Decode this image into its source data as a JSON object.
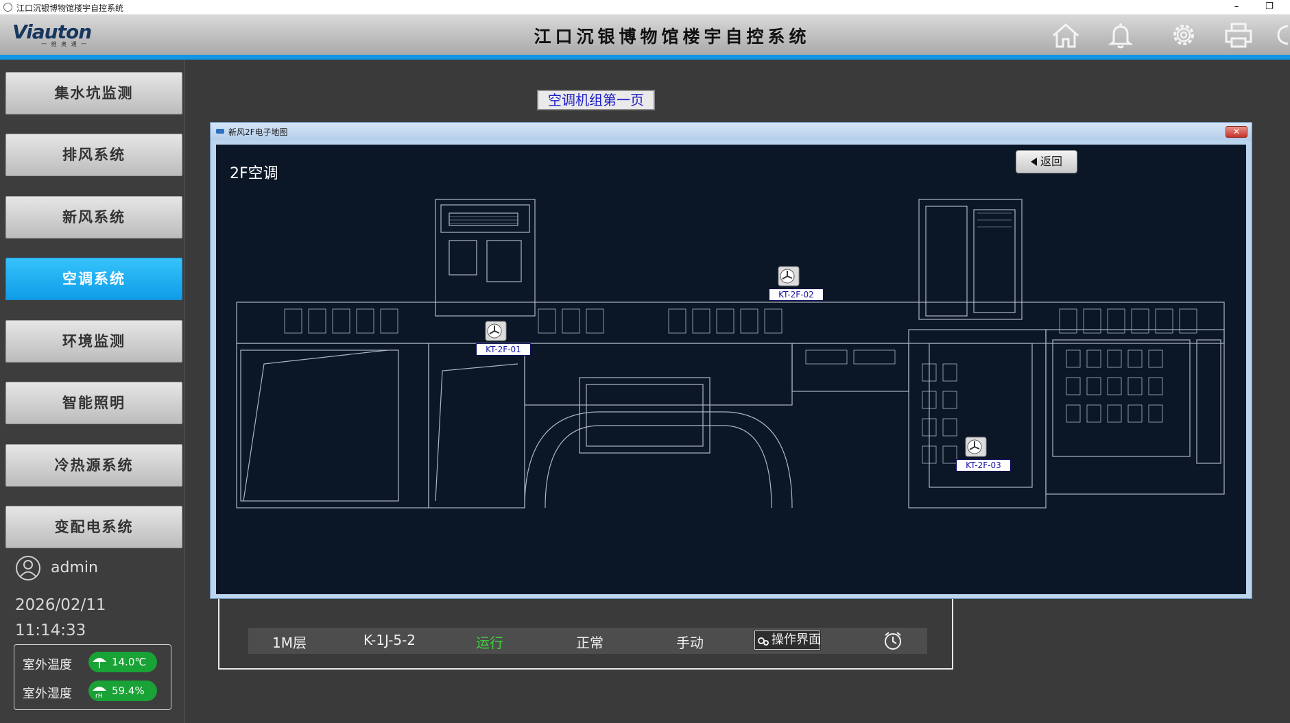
{
  "window": {
    "title": "江口沉银博物馆楼宇自控系统",
    "minimize": "–",
    "maximize": "❐"
  },
  "header": {
    "logo_main": "Viauton",
    "logo_sub": "一 维 奥 通 一",
    "title": "江口沉银博物馆楼宇自控系统"
  },
  "sidebar": {
    "items": [
      {
        "label": "集水坑监测",
        "active": false
      },
      {
        "label": "排风系统",
        "active": false
      },
      {
        "label": "新风系统",
        "active": false
      },
      {
        "label": "空调系统",
        "active": true
      },
      {
        "label": "环境监测",
        "active": false
      },
      {
        "label": "智能照明",
        "active": false
      },
      {
        "label": "冷热源系统",
        "active": false
      },
      {
        "label": "变配电系统",
        "active": false
      }
    ],
    "user": "admin",
    "date": "2026/02/11",
    "time": "11:14:33",
    "weather": {
      "temp_label": "室外温度",
      "temp_value": "14.0℃",
      "hum_label": "室外湿度",
      "hum_value": "59.4%"
    }
  },
  "main": {
    "page_link": "空调机组第一页",
    "status_row": {
      "floor": "1M层",
      "unit_id": "K-1J-5-2",
      "run_state": "运行",
      "fault_state": "正常",
      "mode": "手动",
      "op_button": "操作界面"
    },
    "accent_green": "#3ed23a"
  },
  "popup": {
    "title": "新风2F电子地图",
    "close": "✕",
    "floor_title": "2F空调",
    "back_label": "返回",
    "units": [
      {
        "id": "KT-2F-01"
      },
      {
        "id": "KT-2F-02"
      },
      {
        "id": "KT-2F-03"
      }
    ]
  }
}
